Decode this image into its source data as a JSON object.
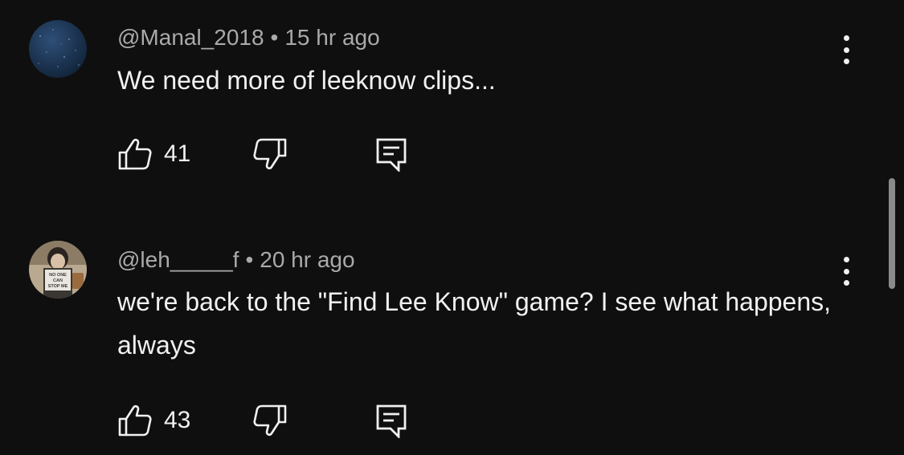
{
  "comments": [
    {
      "handle": "@Manal_2018",
      "separator": "•",
      "time": "15 hr ago",
      "text": "We need more of leeknow clips...",
      "likes": "41",
      "avatar_icon": "starry-night-avatar"
    },
    {
      "handle": "@leh_____f",
      "separator": "•",
      "time": "20 hr ago",
      "text": "we're back to the \"Find Lee Know\" game? I see what happens, always",
      "likes": "43",
      "avatar_icon": "photo-avatar",
      "avatar_caption": [
        "NO ONE",
        "CAN",
        "STOP ME"
      ]
    }
  ],
  "colors": {
    "background": "#0f0f0f",
    "text": "#f1f1f1",
    "meta": "#aaaaaa",
    "scrollbar": "#8a8a8a"
  }
}
